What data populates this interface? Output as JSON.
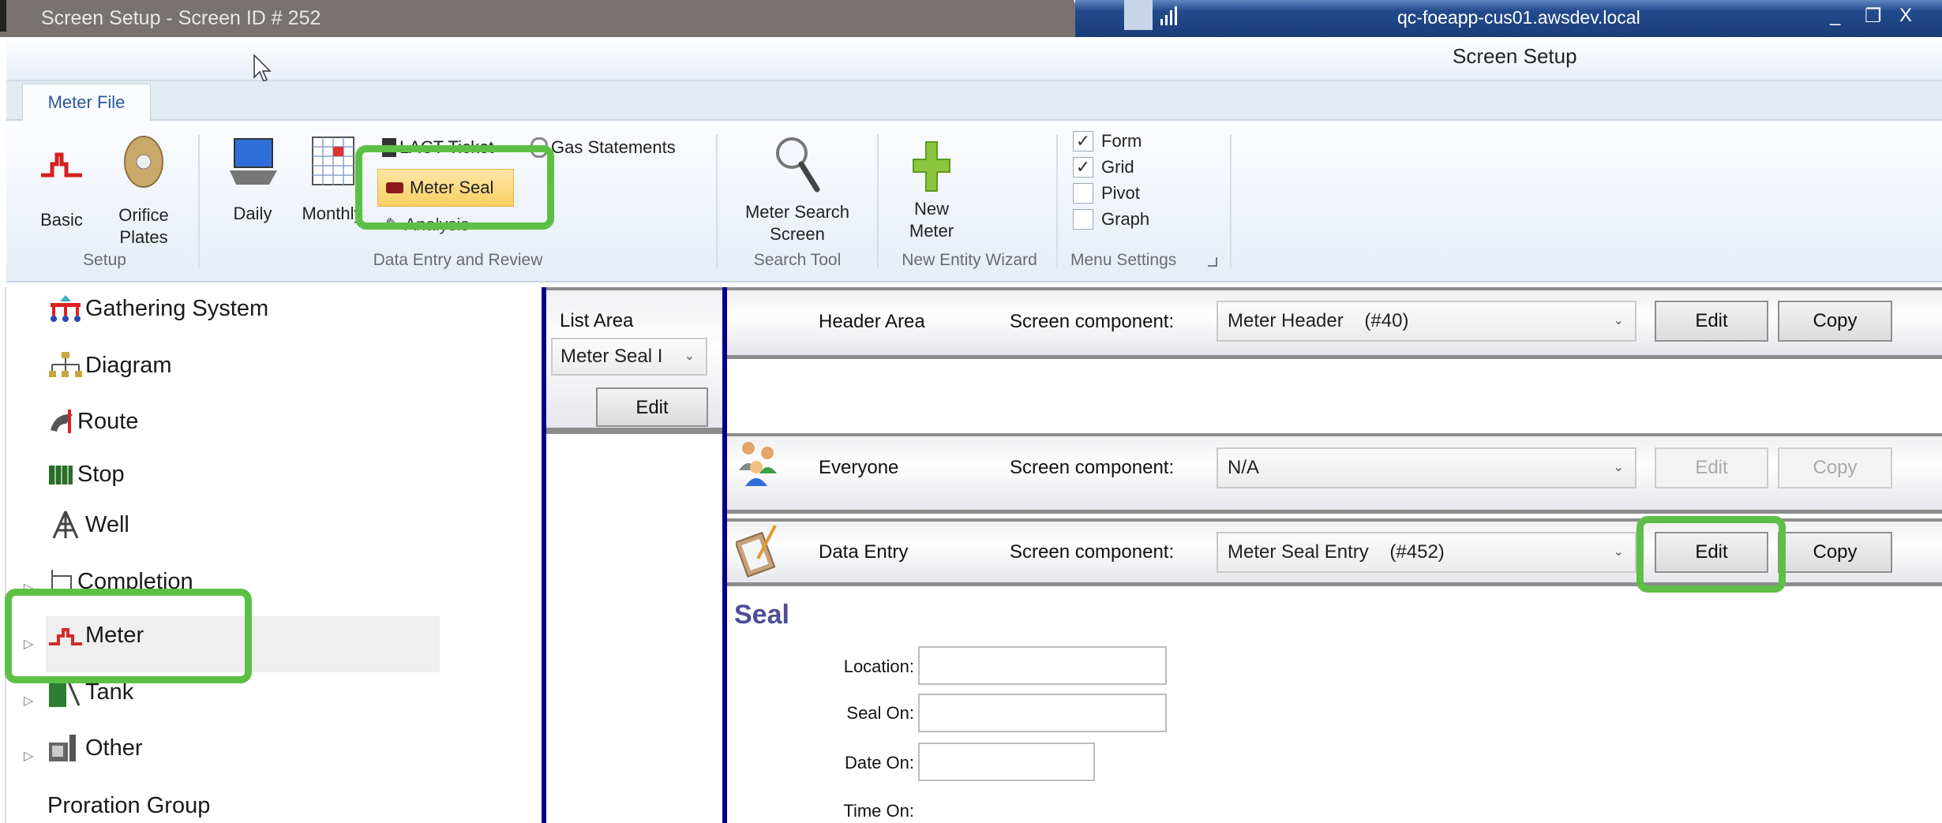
{
  "window": {
    "title": "Screen Setup - Screen ID # 252",
    "host": "qc-foeapp-cus01.awsdev.local",
    "minimize": "_",
    "restore": "❐",
    "close": "X"
  },
  "header": {
    "title": "Screen Setup"
  },
  "ribbon": {
    "tab": "Meter File",
    "setup": {
      "basic": "Basic",
      "orifice1": "Orifice",
      "orifice2": "Plates",
      "group": "Setup"
    },
    "data_entry": {
      "daily": "Daily",
      "monthly": "Monthly",
      "lact": "LACT Ticket",
      "gas": "Gas Statements",
      "meter_seal": "Meter Seal",
      "analysis": "Analysis",
      "group": "Data Entry and Review"
    },
    "search": {
      "label1": "Meter Search",
      "label2": "Screen",
      "group": "Search Tool"
    },
    "wizard": {
      "label1": "New",
      "label2": "Meter",
      "group": "New Entity Wizard"
    },
    "menu": {
      "form": "Form",
      "form_checked": true,
      "grid": "Grid",
      "grid_checked": true,
      "pivot": "Pivot",
      "pivot_checked": false,
      "graph": "Graph",
      "graph_checked": false,
      "group": "Menu Settings",
      "check": "✓"
    }
  },
  "tree": {
    "items": [
      "Gathering System",
      "Diagram",
      "Route",
      "Stop",
      "Well",
      "Completion",
      "Meter",
      "Tank",
      "Other",
      "Proration Group"
    ],
    "selected": "Meter"
  },
  "list_area": {
    "title": "List Area",
    "value": "Meter Seal I",
    "edit": "Edit"
  },
  "rows": [
    {
      "name": "Header Area",
      "label": "Screen component:",
      "value": "Meter Header    (#40)",
      "edit": "Edit",
      "copy": "Copy",
      "enabled": true
    },
    {
      "name": "Everyone",
      "label": "Screen component:",
      "value": "N/A",
      "edit": "Edit",
      "copy": "Copy",
      "enabled": false
    },
    {
      "name": "Data Entry",
      "label": "Screen component:",
      "value": "Meter Seal Entry    (#452)",
      "edit": "Edit",
      "copy": "Copy",
      "enabled": true
    }
  ],
  "form": {
    "section": "Seal",
    "location": "Location:",
    "seal_on": "Seal On:",
    "date_on": "Date On:",
    "time_on": "Time On:"
  },
  "colors": {
    "highlight": "#5dc046",
    "section_title": "#4d4d99",
    "divider": "#00008b"
  }
}
